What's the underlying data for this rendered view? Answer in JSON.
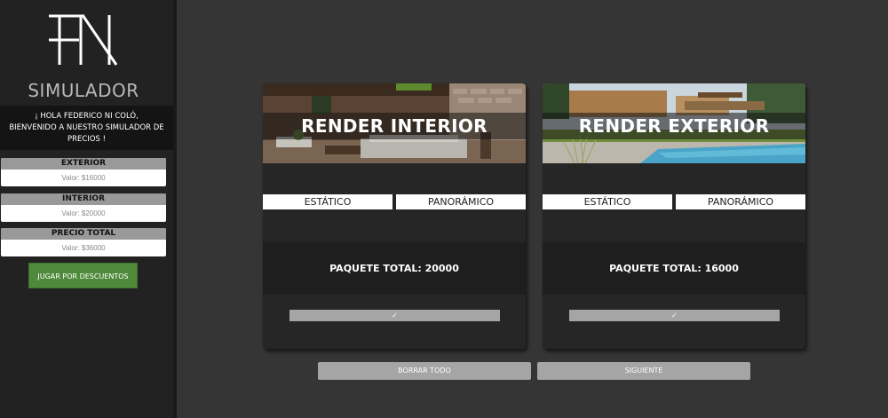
{
  "sidebar": {
    "title": "SIMULADOR",
    "greeting_line1": "¡ HOLA FEDERICO NI COLÓ,",
    "greeting_line2": "BIENVENIDO A NUESTRO SIMULADOR DE",
    "greeting_line3": "PRECIOS !",
    "prices": [
      {
        "label": "EXTERIOR",
        "value": "Valor: $16000"
      },
      {
        "label": "INTERIOR",
        "value": "Valor: $20000"
      },
      {
        "label": "PRECIO TOTAL",
        "value": "Valor: $36000"
      }
    ],
    "play_button": "JUGAR POR DESCUENTOS"
  },
  "cards": [
    {
      "title": "RENDER INTERIOR",
      "option_static": "ESTÁTICO",
      "option_panoramic": "PANORÁMICO",
      "total": "PAQUETE TOTAL: 20000",
      "check": "✓"
    },
    {
      "title": "RENDER EXTERIOR",
      "option_static": "ESTÁTICO",
      "option_panoramic": "PANORÁMICO",
      "total": "PAQUETE TOTAL: 16000",
      "check": "✓"
    }
  ],
  "actions": {
    "clear": "BORRAR TODO",
    "next": "SIGUIENTE"
  },
  "colors": {
    "background": "#353535",
    "sidebar": "#222222",
    "accent_green": "#4f8a3c",
    "button_gray": "#a5a5a5"
  }
}
